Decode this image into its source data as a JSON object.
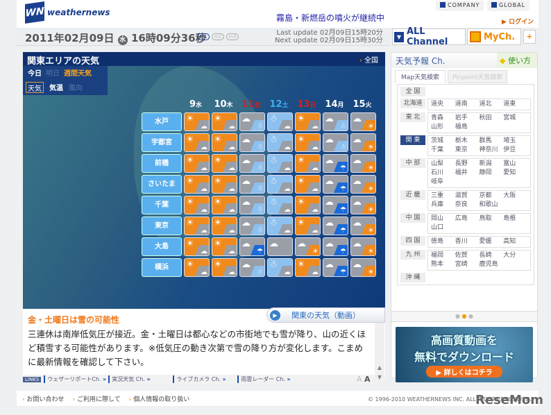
{
  "header": {
    "logo_text": "weathernews",
    "headline": "霧島・新燃岳の噴火が継続中",
    "company": "COMPANY",
    "global": "GLOBAL",
    "login": "ログイン"
  },
  "datebar": {
    "date": "2011年02月09日",
    "weekday": "水",
    "time": "16時09分36秒",
    "modes": [
      "m1",
      "m2",
      "m3"
    ],
    "last_update": "Last update  02月09日15時20分",
    "next_update": "Next update  02月09日15時30分"
  },
  "channel": {
    "all": "ALL Channel",
    "my": "MyCh.",
    "plus": "+"
  },
  "main": {
    "title": "関東エリアの天気",
    "zenkoku": "全国",
    "tabs_day": [
      "今日",
      "明日",
      "週間天気"
    ],
    "tabs_kind": [
      "天気",
      "気温",
      "風向"
    ],
    "days": [
      {
        "d": "9",
        "w": "水",
        "color": "#ffffff"
      },
      {
        "d": "10",
        "w": "木",
        "color": "#ffffff"
      },
      {
        "d": "11",
        "w": "金",
        "color": "#d02020"
      },
      {
        "d": "12",
        "w": "土",
        "color": "#40b0f0"
      },
      {
        "d": "13",
        "w": "日",
        "color": "#d02020"
      },
      {
        "d": "14",
        "w": "月",
        "color": "#ffffff"
      },
      {
        "d": "15",
        "w": "火",
        "color": "#ffffff"
      }
    ],
    "rows": [
      {
        "city": "水戸",
        "w": [
          "sun/cloud",
          "sun/cloud",
          "cloud/snow",
          "snow/cloud",
          "sun/cloud",
          "cloud/snow",
          "cloud/sun"
        ]
      },
      {
        "city": "宇都宮",
        "w": [
          "sun/cloud",
          "sun/cloud",
          "cloud/snow",
          "snow/cloud",
          "sun/cloud",
          "cloud/snow",
          "cloud/sun"
        ]
      },
      {
        "city": "前橋",
        "w": [
          "sun/cloud",
          "sun/cloud",
          "cloud/snow",
          "snow/cloud",
          "sun/cloud",
          "cloud/rain",
          "cloud/sun"
        ]
      },
      {
        "city": "さいたま",
        "w": [
          "sun/cloud",
          "sun/cloud",
          "cloud/snow",
          "snow/cloud",
          "sun/cloud",
          "cloud/rain",
          "cloud/sun"
        ]
      },
      {
        "city": "千葉",
        "w": [
          "sun/cloud",
          "sun/cloud",
          "cloud/snow",
          "snow/cloud",
          "sun/cloud",
          "cloud/rain",
          "cloud/sun"
        ]
      },
      {
        "city": "東京",
        "w": [
          "sun/cloud",
          "sun/cloud",
          "cloud/snow",
          "snow/cloud",
          "sun/cloud",
          "cloud/rain",
          "cloud/sun"
        ]
      },
      {
        "city": "大島",
        "w": [
          "sun/cloud",
          "sun/cloud",
          "cloud/rain",
          "cloud",
          "cloud/sun",
          "cloud/rain",
          "cloud/sun"
        ]
      },
      {
        "city": "横浜",
        "w": [
          "sun/cloud",
          "sun/cloud",
          "cloud/snow",
          "snow/cloud",
          "sun/cloud",
          "cloud/rain",
          "cloud/sun"
        ]
      }
    ],
    "movie": "関東の天気（動画）"
  },
  "news": {
    "title": "金・土曜日は雪の可能性",
    "body": "三連休は南岸低気圧が接近。金・土曜日は都心などの市街地でも雪が降り、山の近くほど積雪する可能性があります。※低気圧の動き次第で雪の降り方が変化します。こまめに最新情報を確認して下さい。"
  },
  "links": {
    "label": "LINKS",
    "items": [
      "ウェザーリポートCh.",
      "実況天気 Ch.",
      "ライブカメラ Ch.",
      "雨雲レーダー Ch."
    ],
    "font_small": "A",
    "font_large": "A"
  },
  "side": {
    "title": "天気予報 Ch.",
    "howto": "使い方",
    "tabs": [
      "Map天気検索",
      "Pinpoint天気検索"
    ],
    "regions": [
      {
        "name": "全 国",
        "prefs": []
      },
      {
        "name": "北海道",
        "prefs": [
          "道央",
          "道南",
          "道北",
          "道東"
        ]
      },
      {
        "name": "東 北",
        "prefs": [
          "青森",
          "岩手",
          "秋田",
          "宮城",
          "山形",
          "福島"
        ]
      },
      {
        "name": "関 東",
        "prefs": [
          "茨城",
          "栃木",
          "群馬",
          "埼玉",
          "千葉",
          "東京",
          "神奈川",
          "伊豆"
        ],
        "active": true
      },
      {
        "name": "中 部",
        "prefs": [
          "山梨",
          "長野",
          "新潟",
          "富山",
          "石川",
          "福井",
          "静岡",
          "愛知",
          "岐阜"
        ]
      },
      {
        "name": "近 畿",
        "prefs": [
          "三重",
          "滋賀",
          "京都",
          "大阪",
          "兵庫",
          "奈良",
          "和歌山"
        ]
      },
      {
        "name": "中 国",
        "prefs": [
          "岡山",
          "広島",
          "鳥取",
          "島根",
          "山口"
        ]
      },
      {
        "name": "四 国",
        "prefs": [
          "徳島",
          "香川",
          "愛媛",
          "高知"
        ]
      },
      {
        "name": "九 州",
        "prefs": [
          "福岡",
          "佐賀",
          "長崎",
          "大分",
          "熊本",
          "宮崎",
          "鹿児島"
        ]
      },
      {
        "name": "沖 縄",
        "prefs": []
      }
    ],
    "banner": {
      "line1": "高画質動画を",
      "line2": "無料でダウンロード",
      "button": "▶ 詳しくはコチラ"
    }
  },
  "footer": {
    "links": [
      "お問い合わせ",
      "ご利用に際して",
      "個人情報の取り扱い"
    ],
    "copyright": "© 1996-2010 WEATHERNEWS INC. ALL RIGHTS RESERVED.",
    "watermark": "ReseMom"
  },
  "colors": {
    "sun": "#f08a1c",
    "cloud": "#9a9ea6",
    "snow": "#8cc0ee",
    "rain": "#1a6ad8"
  }
}
